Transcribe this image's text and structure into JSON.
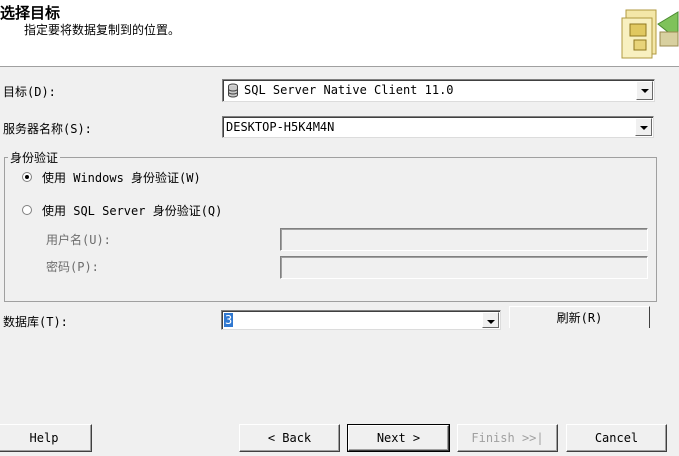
{
  "header": {
    "title": "选择目标",
    "subtitle": "指定要将数据复制到的位置。"
  },
  "form": {
    "destination_label": "目标(D):",
    "destination_value": "SQL Server Native Client 11.0",
    "server_label": "服务器名称(S):",
    "server_value": "DESKTOP-H5K4M4N",
    "auth_group_title": "身份验证",
    "auth_windows_label": "使用 Windows 身份验证(W)",
    "auth_sql_label": "使用 SQL Server 身份验证(Q)",
    "username_label": "用户名(U):",
    "username_value": "",
    "password_label": "密码(P):",
    "password_value": "",
    "database_label": "数据库(T):",
    "database_value": "3",
    "refresh_label": "刷新(R)"
  },
  "auth_selected": "windows",
  "footer": {
    "help": "Help",
    "back": "< Back",
    "next": "Next >",
    "finish": "Finish >>|",
    "cancel": "Cancel"
  },
  "icons": [
    "database-icon",
    "wizard-icon",
    "chevron-down-icon"
  ]
}
